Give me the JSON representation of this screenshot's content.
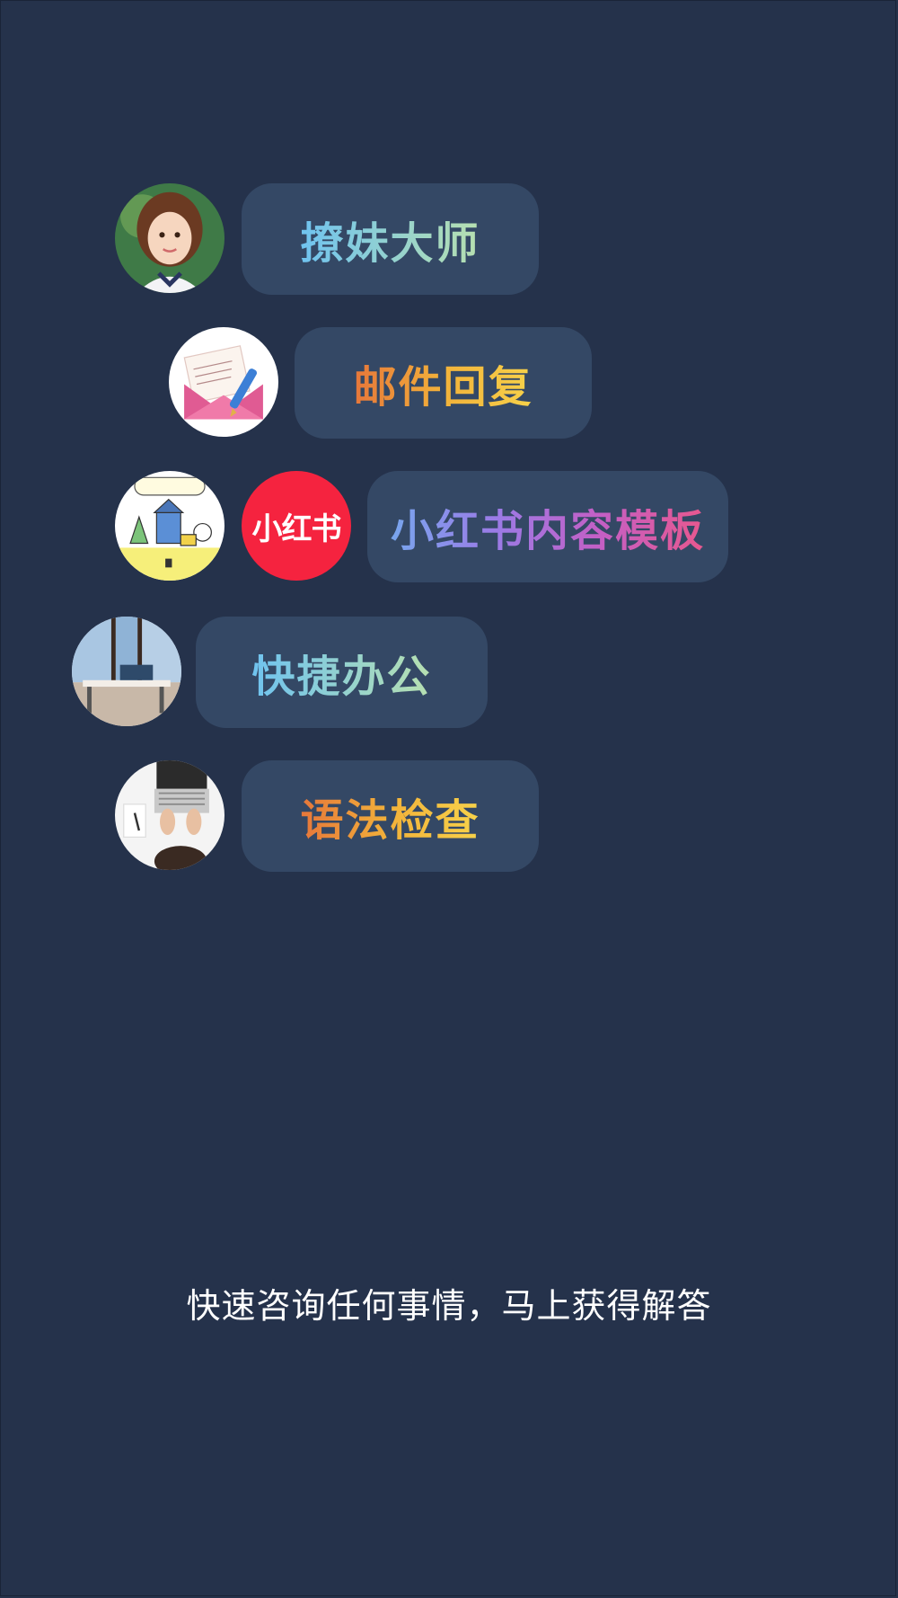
{
  "items": [
    {
      "label": "撩妹大师",
      "avatar_icon": "girl-portrait-icon"
    },
    {
      "label": "邮件回复",
      "avatar_icon": "envelope-pen-icon"
    },
    {
      "label": "小红书内容模板",
      "avatar_icon": "cartoon-scene-icon",
      "brand_logo": "小红书",
      "brand_icon": "xiaohongshu-logo-icon"
    },
    {
      "label": "快捷办公",
      "avatar_icon": "office-desk-icon"
    },
    {
      "label": "语法检查",
      "avatar_icon": "laptop-typing-icon"
    }
  ],
  "tagline": "快速咨询任何事情，马上获得解答",
  "colors": {
    "background": "#25324b",
    "pill": "#344865",
    "brand_red": "#f5233f"
  }
}
